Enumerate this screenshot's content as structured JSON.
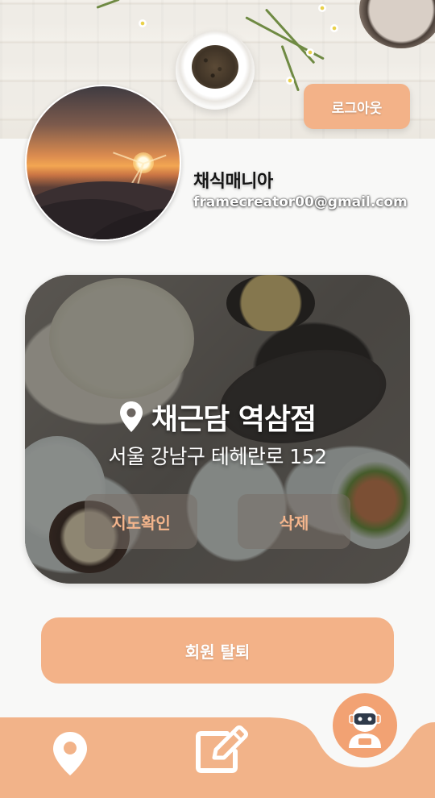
{
  "header": {
    "logout_label": "로그아웃"
  },
  "profile": {
    "name": "채식매니아",
    "email": "framecreator00@gmail.com"
  },
  "store_card": {
    "name": "채근담 역삼점",
    "address": "서울 강남구 테헤란로 152",
    "map_button_label": "지도확인",
    "delete_button_label": "삭제"
  },
  "withdraw": {
    "label": "회원 탈퇴"
  },
  "bottom_nav": {
    "items": [
      {
        "icon": "map-pin-icon"
      },
      {
        "icon": "edit-icon"
      },
      {
        "icon": "chatbot-icon"
      }
    ]
  },
  "colors": {
    "accent": "#f3b288",
    "nav_bar": "#f2b389",
    "nav_bot": "#f2a273",
    "background": "#f8f8f7"
  }
}
